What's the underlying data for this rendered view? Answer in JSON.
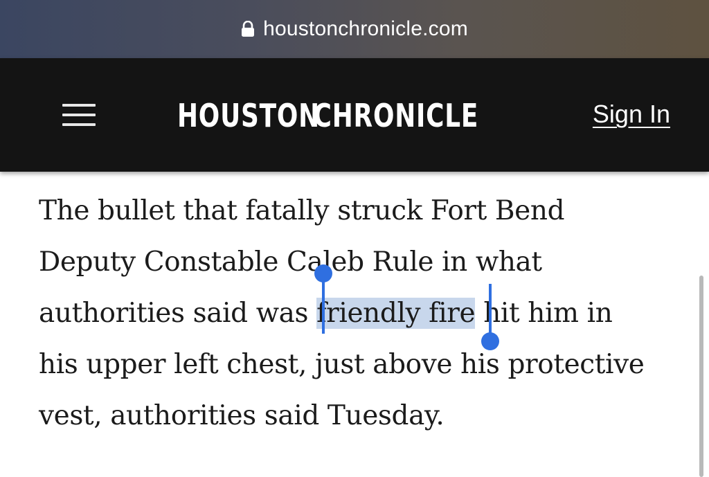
{
  "browser": {
    "url": "houstonchronicle.com",
    "lock_icon": "lock-icon"
  },
  "header": {
    "logo_left": "HOUSTON",
    "logo_right": "CHRONICLE",
    "logo_star_color": "#e3b866",
    "menu_icon": "hamburger-menu-icon",
    "signin_label": "Sign In"
  },
  "article": {
    "lines": [
      "The bullet that fatally struck Fort Bend",
      "Deputy Constable Caleb Rule in what",
      "authorities said was ",
      "his upper left chest, just above his protective",
      "vest, authorities said Tuesday."
    ],
    "line3_selected": "friendly fire",
    "line3_after": " hit him in",
    "selection_color": "#c8d7ec",
    "selection_handle_color": "#2f6fe0"
  }
}
